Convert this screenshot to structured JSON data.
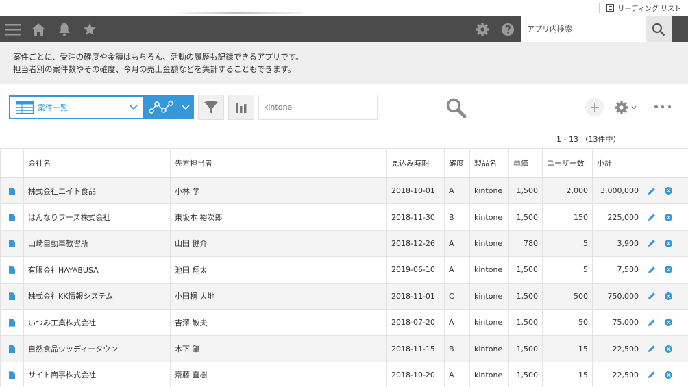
{
  "browser": {
    "reading_list_label": "リーディング リスト"
  },
  "header": {
    "search_placeholder": "アプリ内検索"
  },
  "description": {
    "line1": "案件ごとに、受注の確度や金額はもちろん、活動の履歴も記録できるアプリです。",
    "line2": "担当者別の案件数やその確度、今月の売上金額などを集計することもできます。"
  },
  "toolbar": {
    "view_label": "案件一覧",
    "keyword_value": "kintone"
  },
  "pagination": {
    "text": "1 - 13 （13件中）"
  },
  "table": {
    "columns": [
      "会社名",
      "先方担当者",
      "見込み時期",
      "確度",
      "製品名",
      "単価",
      "ユーザー数",
      "小計"
    ],
    "rows": [
      [
        "株式会社エイト食品",
        "小林 学",
        "2018-10-01",
        "A",
        "kintone",
        "1,500",
        "2,000",
        "3,000,000"
      ],
      [
        "はんなりフーズ株式会社",
        "東坂本 裕次郎",
        "2018-11-30",
        "B",
        "kintone",
        "1,500",
        "150",
        "225,000"
      ],
      [
        "山崎自動車教習所",
        "山田 健介",
        "2018-12-26",
        "A",
        "kintone",
        "780",
        "5",
        "3,900"
      ],
      [
        "有限会社HAYABUSA",
        "池田 翔太",
        "2019-06-10",
        "A",
        "kintone",
        "1,500",
        "5",
        "7,500"
      ],
      [
        "株式会社KK情報システム",
        "小田桐 大地",
        "2018-11-01",
        "C",
        "kintone",
        "1,500",
        "500",
        "750,000"
      ],
      [
        "いつみ工業株式会社",
        "吉澤 敏夫",
        "2018-07-20",
        "A",
        "kintone",
        "1,500",
        "50",
        "75,000"
      ],
      [
        "自然食品ウッディータウン",
        "木下 肇",
        "2018-11-15",
        "B",
        "kintone",
        "1,500",
        "15",
        "22,500"
      ],
      [
        "サイト商事株式会社",
        "斎藤 直樹",
        "2018-10-20",
        "A",
        "kintone",
        "1,500",
        "15",
        "22,500"
      ]
    ]
  },
  "colors": {
    "accent": "#3498db",
    "header_bg": "#4b4b4b",
    "desc_bg": "#efefef",
    "row_alt": "#f4f4f4"
  },
  "icons": [
    "menu-icon",
    "home-icon",
    "bell-icon",
    "star-icon",
    "gear-icon",
    "help-icon",
    "search-icon",
    "table-view-icon",
    "chevron-down-icon",
    "graph-icon",
    "filter-icon",
    "bar-chart-icon",
    "magnifier-icon",
    "plus-icon",
    "more-icon",
    "document-icon",
    "pencil-icon",
    "delete-icon"
  ]
}
